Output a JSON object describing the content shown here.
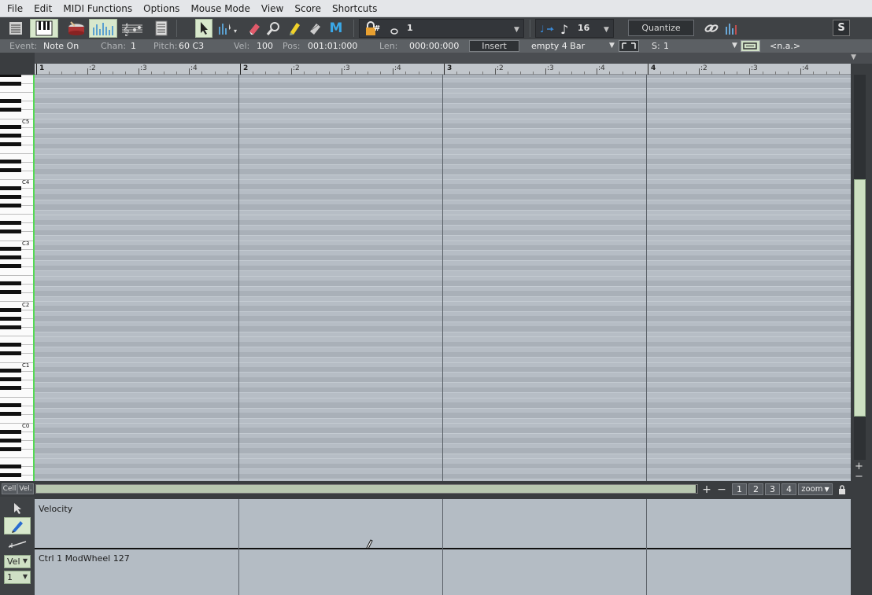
{
  "menu": [
    "File",
    "Edit",
    "MIDI Functions",
    "Options",
    "Mouse Mode",
    "View",
    "Score",
    "Shortcuts"
  ],
  "toolbar": {
    "snap_value": "1",
    "note_len_value": "16",
    "quantize_label": "Quantize",
    "s_label": "S"
  },
  "eventbar": {
    "event_label": "Event:",
    "event_value": "Note On",
    "chan_label": "Chan:",
    "chan_value": "1",
    "pitch_label": "Pitch:",
    "pitch_value": "60 C3",
    "vel_label": "Vel:",
    "vel_value": "100",
    "pos_label": "Pos:",
    "pos_value": "001:01:000",
    "len_label": "Len:",
    "len_value": "000:00:000",
    "insert_label": "Insert",
    "pattern_value": "empty 4 Bar",
    "s_label": "S:",
    "s_value": "1",
    "na_value": "<n.a.>"
  },
  "ruler": {
    "bars": [
      "1",
      "2",
      "3",
      "4"
    ],
    "beats": [
      ":2",
      ":3",
      ":4"
    ]
  },
  "keyboard": {
    "octave_labels": [
      "C5",
      "C4",
      "C3",
      "C2",
      "C1",
      "C0"
    ]
  },
  "hscroll": {
    "cell_label": "Cell",
    "vel_label": "Vel.",
    "plus": "+",
    "minus": "−",
    "zoom_presets": [
      "1",
      "2",
      "3",
      "4"
    ],
    "zoom_label": "zoom"
  },
  "controllers": {
    "lane1_label": "Velocity",
    "lane2_label": "Ctrl  1 ModWheel 127",
    "vel_select": "Vel",
    "ctrl_select": "1"
  },
  "colors": {
    "active_green": "#d8e8cc",
    "grid_bg": "#b6bdc5",
    "key_border": "#55d955"
  }
}
